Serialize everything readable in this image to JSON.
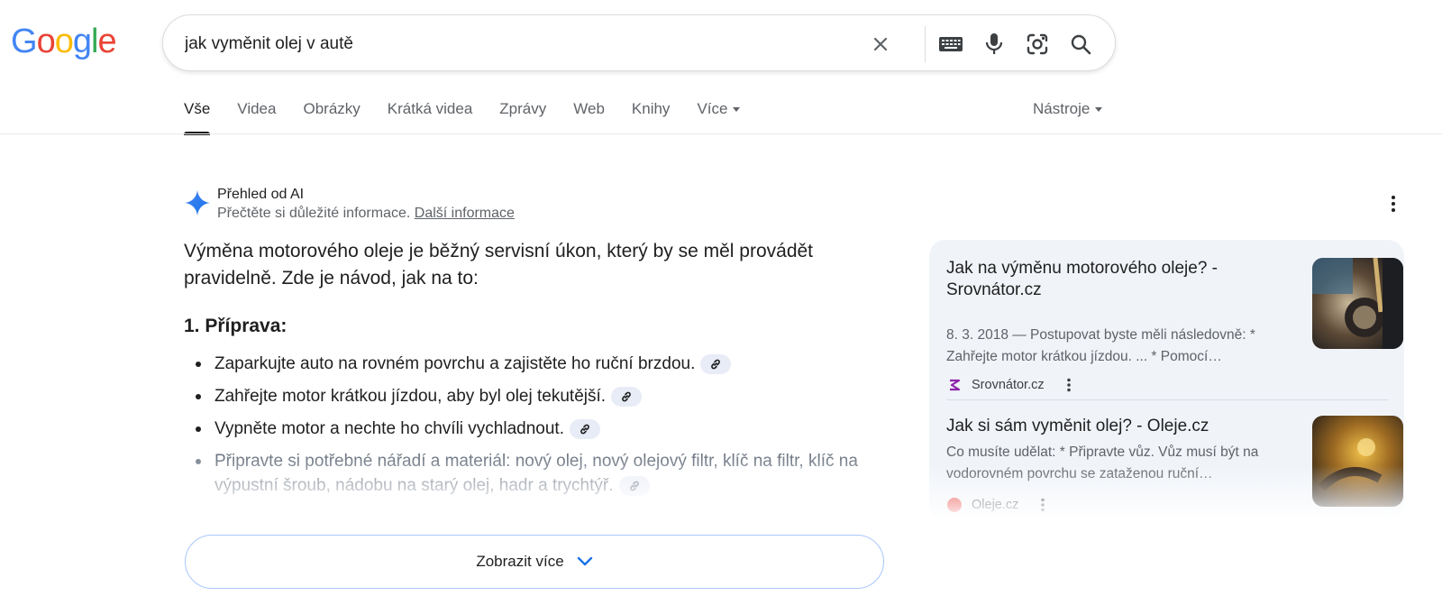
{
  "logo": {
    "letters": [
      "G",
      "o",
      "o",
      "g",
      "l",
      "e"
    ],
    "colors": [
      "#4285f4",
      "#ea4335",
      "#fbbc05",
      "#4285f4",
      "#34a853",
      "#ea4335"
    ]
  },
  "search": {
    "query": "jak vyměnit olej v autě",
    "icons": [
      "close-icon",
      "keyboard-icon",
      "microphone-icon",
      "lens-camera-icon",
      "search-icon"
    ]
  },
  "tabs": [
    {
      "label": "Vše",
      "active": true
    },
    {
      "label": "Videa"
    },
    {
      "label": "Obrázky"
    },
    {
      "label": "Krátká videa"
    },
    {
      "label": "Zprávy"
    },
    {
      "label": "Web"
    },
    {
      "label": "Knihy"
    },
    {
      "label": "Více"
    }
  ],
  "tools_label": "Nástroje",
  "ai_overview": {
    "title": "Přehled od AI",
    "subtitle": "Přečtěte si důležité informace.",
    "learn_more": "Další informace",
    "intro": "Výměna motorového oleje je běžný servisní úkon, který by se měl provádět pravidelně. Zde je návod, jak na to:",
    "step_heading": "1. Příprava:",
    "bullets": [
      "Zaparkujte auto na rovném povrchu a zajistěte ho ruční brzdou.",
      "Zahřejte motor krátkou jízdou, aby byl olej tekutější.",
      "Vypněte motor a nechte ho chvíli vychladnout.",
      "Připravte si potřebné nářadí a materiál: nový olej, nový olejový filtr, klíč na filtr, klíč na výpustní šroub, nádobu na starý olej, hadr a trychtýř."
    ],
    "show_more": "Zobrazit více",
    "accent_color": "#1a73e8"
  },
  "sources": [
    {
      "title": "Jak na výměnu motorového oleje? - Srovnátor.cz",
      "snippet": "8. 3. 2018 — Postupovat byste měli následovně: * Zahřejte motor krátkou jízdou. ... * Pomocí…",
      "site": "Srovnátor.cz",
      "favicon_color": "#8e24aa"
    },
    {
      "title": "Jak si sám vyměnit olej? - Oleje.cz",
      "snippet": "Co musíte udělat: * Připravte vůz. Vůz musí být na vodorovném povrchu se zataženou ruční…",
      "site": "Oleje.cz",
      "favicon_color": "#e53935"
    }
  ]
}
